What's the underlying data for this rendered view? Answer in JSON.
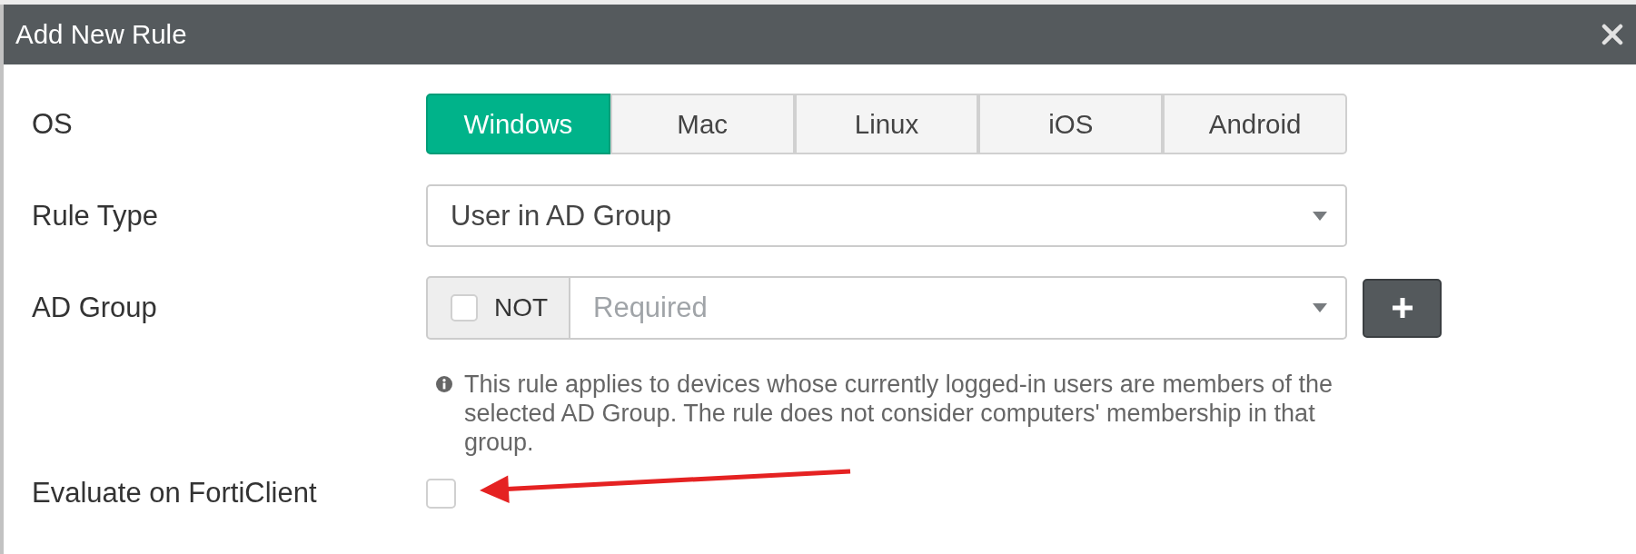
{
  "dialog": {
    "title": "Add New Rule"
  },
  "fields": [
    {
      "kind": "segmented",
      "label": "OS",
      "options": [
        {
          "label": "Windows",
          "selected": true
        },
        {
          "label": "Mac",
          "selected": false
        },
        {
          "label": "Linux",
          "selected": false
        },
        {
          "label": "iOS",
          "selected": false
        },
        {
          "label": "Android",
          "selected": false
        }
      ]
    },
    {
      "kind": "select",
      "label": "Rule Type",
      "value": "User in AD Group"
    },
    {
      "kind": "group_select",
      "label": "AD Group",
      "negate": {
        "label": "NOT",
        "checked": false
      },
      "placeholder": "Required",
      "help": "This rule applies to devices whose currently logged-in users are members of the selected AD Group. The rule does not consider computers' membership in that group."
    },
    {
      "kind": "checkbox",
      "label": "Evaluate on FortiClient",
      "checked": false
    }
  ]
}
